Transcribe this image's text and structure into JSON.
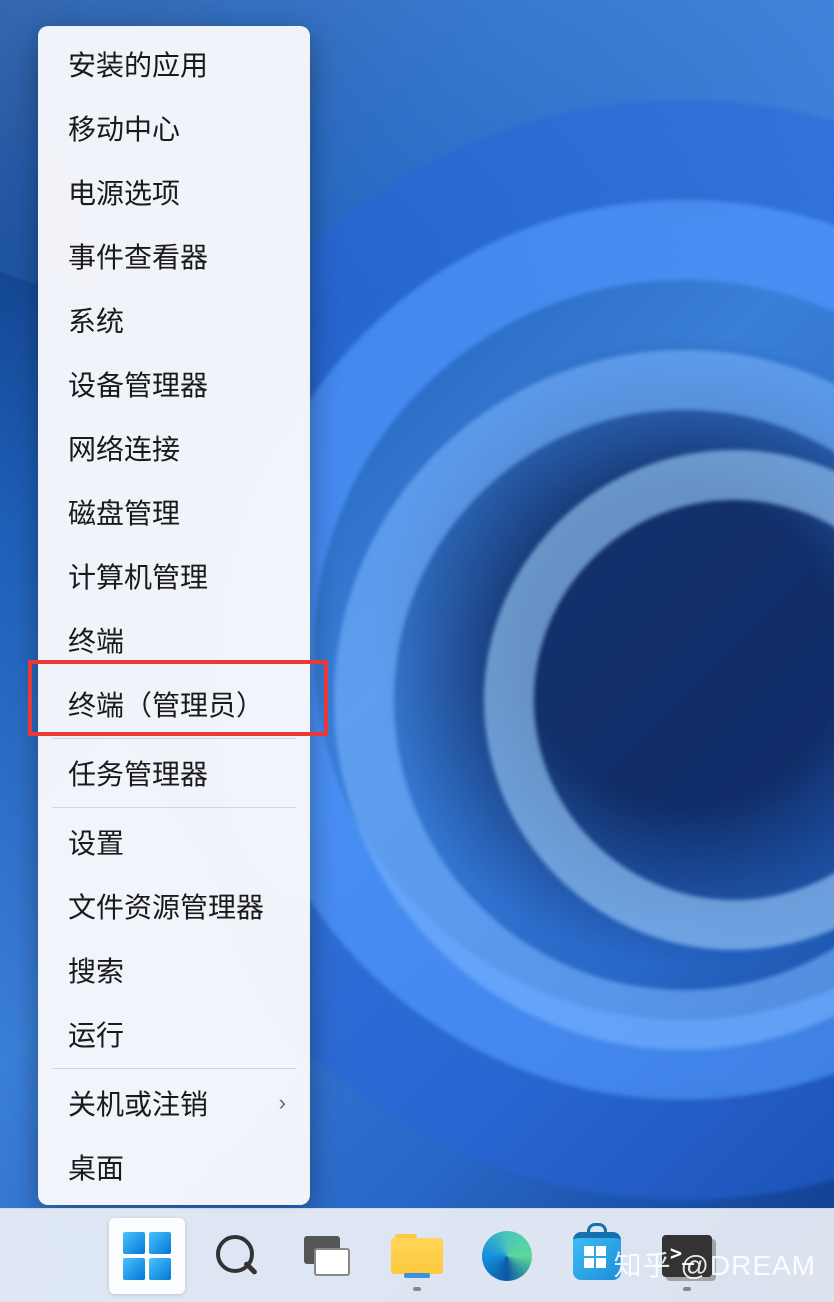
{
  "context_menu": {
    "items": [
      {
        "label": "安装的应用"
      },
      {
        "label": "移动中心"
      },
      {
        "label": "电源选项"
      },
      {
        "label": "事件查看器"
      },
      {
        "label": "系统"
      },
      {
        "label": "设备管理器"
      },
      {
        "label": "网络连接"
      },
      {
        "label": "磁盘管理"
      },
      {
        "label": "计算机管理"
      },
      {
        "label": "终端"
      },
      {
        "label": "终端（管理员）",
        "highlighted": true
      },
      {
        "label": "任务管理器"
      },
      {
        "label": "设置"
      },
      {
        "label": "文件资源管理器"
      },
      {
        "label": "搜索"
      },
      {
        "label": "运行"
      },
      {
        "label": "关机或注销",
        "has_submenu": true
      },
      {
        "label": "桌面"
      }
    ],
    "separators_after": [
      10,
      11,
      15
    ]
  },
  "taskbar": {
    "icons": [
      {
        "name": "start",
        "active": true
      },
      {
        "name": "search"
      },
      {
        "name": "task-view"
      },
      {
        "name": "file-explorer"
      },
      {
        "name": "edge"
      },
      {
        "name": "microsoft-store"
      },
      {
        "name": "terminal"
      }
    ]
  },
  "watermark": "知乎 @DREAM",
  "highlight_color": "#e83838"
}
